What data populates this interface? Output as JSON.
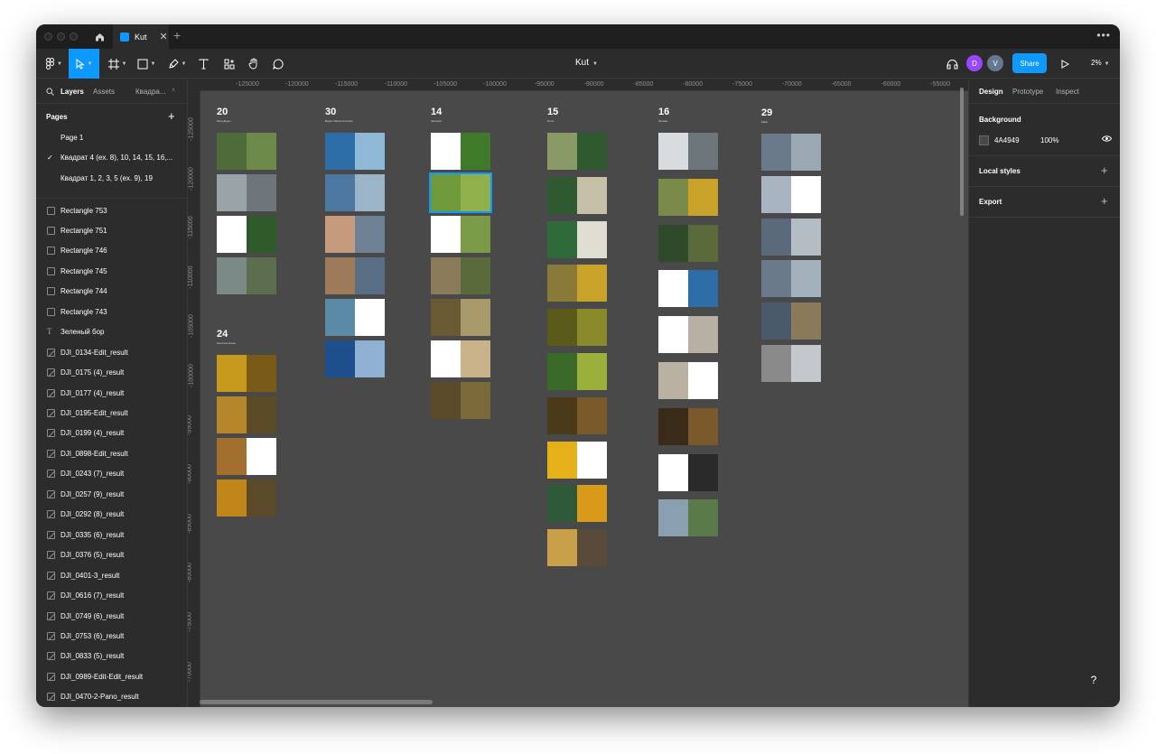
{
  "tabbar": {
    "file_name": "Kut",
    "new_tab": "+",
    "more": "•••"
  },
  "toolbar": {
    "doc_title": "Kut",
    "avatar_1": "D",
    "avatar_2": "V",
    "share_label": "Share",
    "zoom": "2%"
  },
  "left_panel": {
    "tabs": [
      "Layers",
      "Assets",
      "Квадра..."
    ],
    "pages_heading": "Pages",
    "pages": [
      "Page 1",
      "Квадрат 4 (ex. 8), 10, 14, 15, 16,...",
      "Квадрат 1, 2, 3, 5 (ex. 9), 19"
    ],
    "selected_page_index": 1,
    "layers": [
      {
        "name": "Rectangle 753",
        "icon": "rectangle-icon"
      },
      {
        "name": "Rectangle 751",
        "icon": "rectangle-icon"
      },
      {
        "name": "Rectangle 746",
        "icon": "rectangle-icon"
      },
      {
        "name": "Rectangle 745",
        "icon": "rectangle-icon"
      },
      {
        "name": "Rectangle 744",
        "icon": "rectangle-icon"
      },
      {
        "name": "Rectangle 743",
        "icon": "rectangle-icon"
      },
      {
        "name": "Зеленый бор",
        "icon": "text-icon"
      },
      {
        "name": "DJI_0134-Edit_result",
        "icon": "image-icon"
      },
      {
        "name": "DJI_0175 (4)_result",
        "icon": "image-icon"
      },
      {
        "name": "DJI_0177 (4)_result",
        "icon": "image-icon"
      },
      {
        "name": "DJI_0195-Edit_result",
        "icon": "image-icon"
      },
      {
        "name": "DJI_0199 (4)_result",
        "icon": "image-icon"
      },
      {
        "name": "DJI_0898-Edit_result",
        "icon": "image-icon"
      },
      {
        "name": "DJI_0243 (7)_result",
        "icon": "image-icon"
      },
      {
        "name": "DJI_0257 (9)_result",
        "icon": "image-icon"
      },
      {
        "name": "DJI_0292 (8)_result",
        "icon": "image-icon"
      },
      {
        "name": "DJI_0335 (6)_result",
        "icon": "image-icon"
      },
      {
        "name": "DJI_0376 (5)_result",
        "icon": "image-icon"
      },
      {
        "name": "DJI_0401-3_result",
        "icon": "image-icon"
      },
      {
        "name": "DJI_0616 (7)_result",
        "icon": "image-icon"
      },
      {
        "name": "DJI_0749 (6)_result",
        "icon": "image-icon"
      },
      {
        "name": "DJI_0753 (6)_result",
        "icon": "image-icon"
      },
      {
        "name": "DJI_0833 (5)_result",
        "icon": "image-icon"
      },
      {
        "name": "DJI_0989-Edit-Edit_result",
        "icon": "image-icon"
      },
      {
        "name": "DJI_0470-2-Pano_result",
        "icon": "image-icon"
      }
    ]
  },
  "canvas": {
    "background": "#4A4949",
    "ruler_h": [
      "-125000",
      "-120000",
      "-115000",
      "-110000",
      "-105000",
      "-100000",
      "-95000",
      "-90000",
      "-85000",
      "-80000",
      "-75000",
      "-70000",
      "-65000",
      "-60000",
      "-55000"
    ],
    "ruler_v": [
      "-125000",
      "-120000",
      "-115000",
      "-110000",
      "-105000",
      "-100000",
      "-95000",
      "-90000",
      "-85000",
      "-80000",
      "-75000",
      "-70000"
    ],
    "columns": [
      {
        "label": "20",
        "sub": "Река Дыры",
        "frames": [
          [
            "#4f6b3a",
            "#6d8a4a"
          ],
          [
            "#9aa3a8",
            "#6e767b"
          ],
          [
            "#ffffff",
            "#2f5a2a"
          ],
          [
            "#7b8a86",
            "#5d6e4f"
          ]
        ]
      },
      {
        "label": "24",
        "sub": "Золотая Осень",
        "frames": [
          [
            "#c79a1e",
            "#7a5a17"
          ],
          [
            "#b5862a",
            "#5b4a26"
          ],
          [
            "#a26f2e",
            "#ffffff"
          ],
          [
            "#c0861a",
            "#5a4a2a"
          ]
        ]
      },
      {
        "label": "30",
        "sub": "Ведёт Малая Козлиха",
        "frames": [
          [
            "#2d6ea8",
            "#8fb7d6"
          ],
          [
            "#4d78a2",
            "#9cb4c8"
          ],
          [
            "#c69a7c",
            "#6e8094"
          ],
          [
            "#9c7a5a",
            "#5a6f86"
          ],
          [
            "#5a8aa6",
            "#ffffff"
          ],
          [
            "#1d4f8c",
            "#8fb0d2"
          ]
        ]
      },
      {
        "label": "14",
        "sub": "Зелёная",
        "frames": [
          [
            "#ffffff",
            "#3f7a2a"
          ],
          [
            "#6f9a3c",
            "#8fb04a"
          ],
          [
            "#ffffff",
            "#7a9a48"
          ],
          [
            "#8a7c5a",
            "#5a6a3a"
          ],
          [
            "#6a5a34",
            "#a89a6a"
          ],
          [
            "#ffffff",
            "#c9b28a"
          ],
          [
            "#5a4a2a",
            "#7a6a3a"
          ]
        ]
      },
      {
        "label": "15",
        "sub": "Поля",
        "frames": [
          [
            "#8a9a66",
            "#2f5a2f"
          ],
          [
            "#2f5a2f",
            "#c7c0a8"
          ],
          [
            "#2f6a3a",
            "#e0ddd2"
          ],
          [
            "#8a7a3a",
            "#c9a22a"
          ],
          [
            "#5a5a1a",
            "#8a8a2a"
          ],
          [
            "#3a6a2a",
            "#9ab03a"
          ],
          [
            "#4a3a1a",
            "#7a5a2a"
          ],
          [
            "#e6b01a",
            "#ffffff"
          ],
          [
            "#2f5a3a",
            "#d99a1a"
          ],
          [
            "#c9a04a",
            "#5a4a3a"
          ]
        ]
      },
      {
        "label": "16",
        "sub": "Лесная",
        "frames": [
          [
            "#d8dcdf",
            "#6d767b"
          ],
          [
            "#7a8a4a",
            "#c9a22a"
          ],
          [
            "#2f4a2a",
            "#5a6a3a"
          ],
          [
            "#ffffff",
            "#2d6ea8"
          ],
          [
            "#ffffff",
            "#b8b0a2"
          ],
          [
            "#b9b1a1",
            "#ffffff"
          ],
          [
            "#3a2a1a",
            "#7a5a2a"
          ],
          [
            "#ffffff",
            "#2a2a2a"
          ],
          [
            "#8aa0b0",
            "#5a7a4a"
          ]
        ]
      },
      {
        "label": "29",
        "sub": "Маки",
        "frames": [
          [
            "#6a7a8a",
            "#9aa8b4"
          ],
          [
            "#a8b4c0",
            "#ffffff"
          ],
          [
            "#5a6a7a",
            "#b4bcc4"
          ],
          [
            "#6a7a8a",
            "#a4b0bc"
          ],
          [
            "#4a5a6a",
            "#8a7a5a"
          ],
          [
            "#8a8a8a",
            "#c4c8cc"
          ]
        ]
      }
    ]
  },
  "right_panel": {
    "tabs": [
      "Design",
      "Prototype",
      "Inspect"
    ],
    "background_heading": "Background",
    "background_hex": "4A4949",
    "background_opacity": "100%",
    "local_styles": "Local styles",
    "export": "Export"
  },
  "help": "?"
}
